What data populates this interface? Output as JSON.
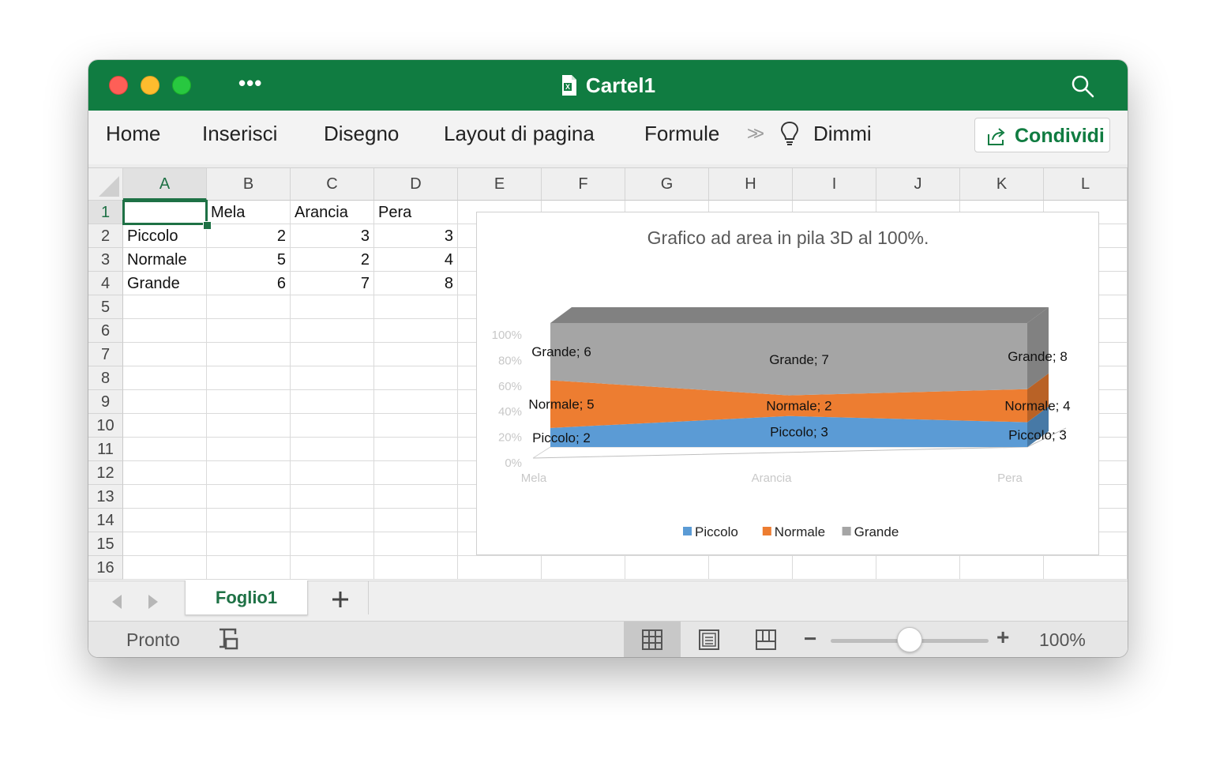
{
  "window": {
    "title": "Cartel1",
    "more_label": "•••",
    "icons": [
      "close-light",
      "minimize-light",
      "zoom-light",
      "more-icon",
      "excel-doc-icon",
      "search-icon"
    ]
  },
  "ribbon": {
    "tabs": [
      "Home",
      "Inserisci",
      "Disegno",
      "Layout di pagina",
      "Formule"
    ],
    "overflow_label": ">>",
    "tell_me": "Dimmi",
    "share_label": "Condividi"
  },
  "grid": {
    "columns": [
      "A",
      "B",
      "C",
      "D",
      "E",
      "F",
      "G",
      "H",
      "I",
      "J",
      "K",
      "L"
    ],
    "rows": [
      "1",
      "2",
      "3",
      "4",
      "5",
      "6",
      "7",
      "8",
      "9",
      "10",
      "11",
      "12",
      "13",
      "14",
      "15",
      "16"
    ],
    "selected_cell": "A1",
    "cells": {
      "B1": "Mela",
      "C1": "Arancia",
      "D1": "Pera",
      "A2": "Piccolo",
      "B2": "2",
      "C2": "3",
      "D2": "3",
      "A3": "Normale",
      "B3": "5",
      "C3": "2",
      "D3": "4",
      "A4": "Grande",
      "B4": "6",
      "C4": "7",
      "D4": "8"
    }
  },
  "chart_data": {
    "type": "area",
    "variant": "3D 100% stacked",
    "title": "Grafico ad area in pila 3D al 100%.",
    "categories": [
      "Mela",
      "Arancia",
      "Pera"
    ],
    "y_ticks": [
      "0%",
      "20%",
      "40%",
      "60%",
      "80%",
      "100%"
    ],
    "ylim": [
      0,
      100
    ],
    "series": [
      {
        "name": "Piccolo",
        "values": [
          2,
          3,
          3
        ],
        "color": "#5b9bd5",
        "labels": [
          "Piccolo; 2",
          "Piccolo; 3",
          "Piccolo; 3"
        ]
      },
      {
        "name": "Normale",
        "values": [
          5,
          2,
          4
        ],
        "color": "#ed7d31",
        "labels": [
          "Normale; 5",
          "Normale; 2",
          "Normale; 4"
        ]
      },
      {
        "name": "Grande",
        "values": [
          6,
          7,
          8
        ],
        "color": "#a5a5a5",
        "labels": [
          "Grande; 6",
          "Grande; 7",
          "Grande; 8"
        ]
      }
    ],
    "legend_position": "bottom",
    "grid": false
  },
  "sheets": {
    "tabs": [
      "Foglio1"
    ],
    "active": "Foglio1",
    "add_label": "+"
  },
  "status": {
    "text": "Pronto",
    "zoom_minus": "−",
    "zoom_plus": "+",
    "zoom": "100%",
    "zoom_fraction": 0.5,
    "active_view": "normal"
  }
}
